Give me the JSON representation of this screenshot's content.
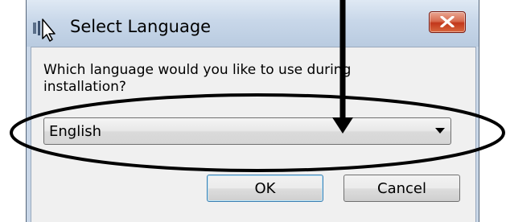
{
  "window": {
    "title": "Select Language",
    "close_icon": "close-x-icon",
    "app_icon": "setup-icon-with-cursor"
  },
  "dialog": {
    "prompt": "Which language would you like to use during installation?",
    "language_select": {
      "selected": "English",
      "arrow_icon": "chevron-down-icon"
    },
    "ok_label": "OK",
    "cancel_label": "Cancel"
  },
  "annotation": {
    "arrow_icon": "arrow-down-icon",
    "ellipse": "highlight-ellipse"
  }
}
